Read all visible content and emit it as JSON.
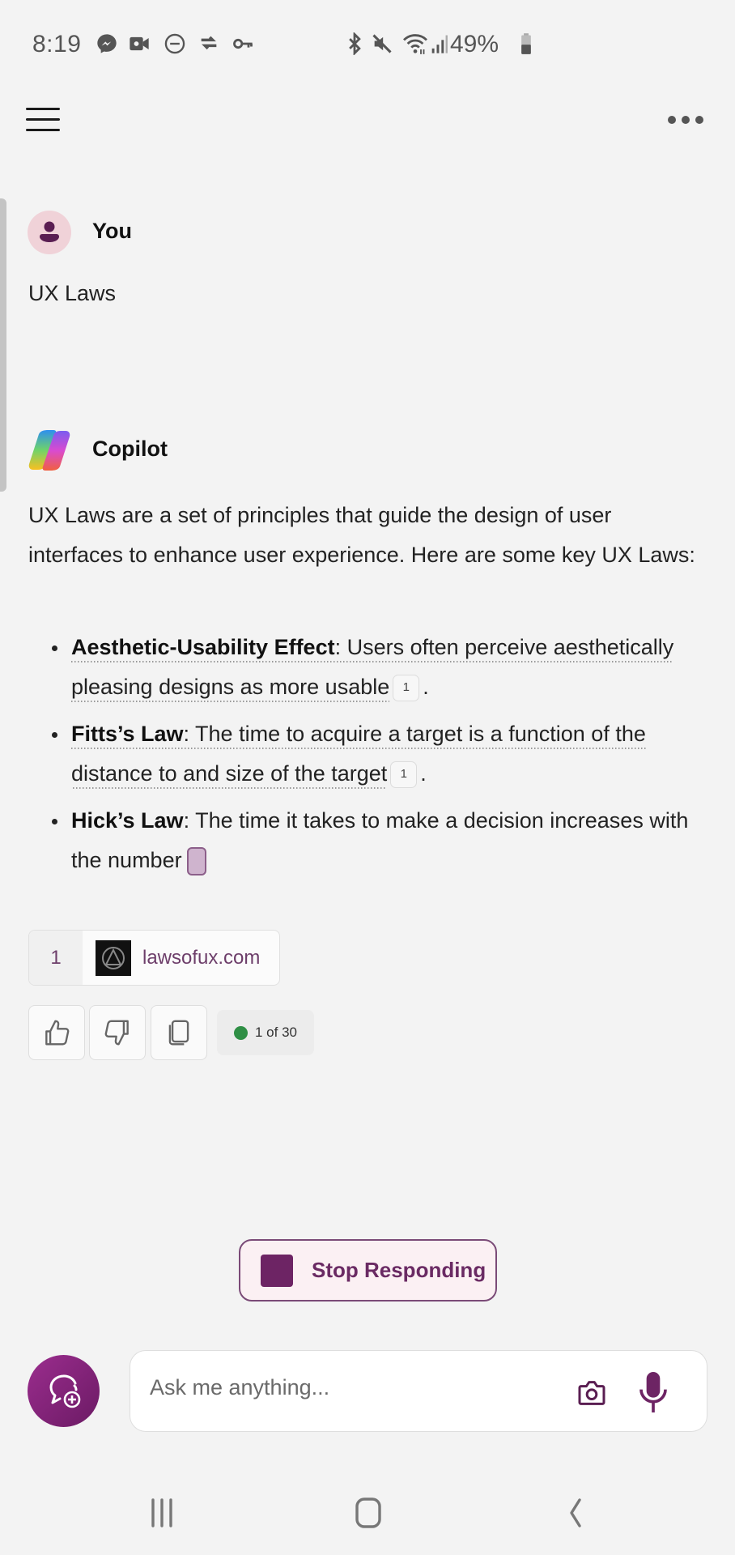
{
  "status_bar": {
    "time": "8:19",
    "left_icons": [
      "messenger-icon",
      "video-call-icon",
      "do-not-disturb-icon",
      "vpn-sync-icon",
      "key-icon"
    ],
    "right_icons": [
      "bluetooth-icon",
      "mute-icon",
      "wifi-icon",
      "signal-icon"
    ],
    "battery_percent": "49%",
    "battery_level": 0.49
  },
  "top_bar": {
    "menu_icon": "hamburger-menu-icon",
    "more_icon": "more-options-icon"
  },
  "conversation": {
    "user": {
      "name": "You",
      "message": "UX Laws"
    },
    "assistant": {
      "name": "Copilot",
      "intro": "UX Laws are a set of principles that guide the design of user interfaces to enhance user experience. Here are some key UX Laws:",
      "items": [
        {
          "term": "Aesthetic-Usability Effect",
          "text": ": Users often perceive aesthetically pleasing designs as more usable",
          "citation": "1",
          "end": "."
        },
        {
          "term": "Fitts’s Law",
          "text": ": The time to acquire a target is a function of the distance to and size of the target",
          "citation": "1",
          "end": "."
        },
        {
          "term": "Hick’s Law",
          "text": ": The time it takes to make a decision increases with the number",
          "citation": null,
          "end": ""
        }
      ],
      "sources": [
        {
          "number": "1",
          "domain": "lawsofux.com"
        }
      ],
      "actions": {
        "like_icon": "thumbs-up-icon",
        "dislike_icon": "thumbs-down-icon",
        "copy_icon": "copy-icon"
      },
      "turn_counter": "1 of 30",
      "counter_status_color": "#2f8f45"
    }
  },
  "stop_button": {
    "label": "Stop Responding"
  },
  "composer": {
    "placeholder": "Ask me anything...",
    "value": "",
    "new_chat_icon": "new-topic-icon",
    "camera_icon": "camera-icon",
    "mic_icon": "microphone-icon"
  },
  "navigation": {
    "recents_icon": "recent-apps-icon",
    "home_icon": "home-icon",
    "back_icon": "back-icon"
  },
  "colors": {
    "accent": "#6d2464",
    "background": "#f3f3f3"
  }
}
